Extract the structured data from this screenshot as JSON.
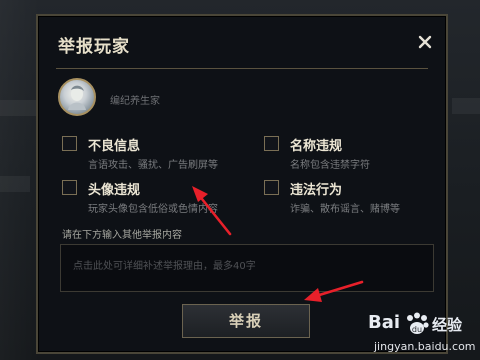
{
  "dialog": {
    "title": "举报玩家",
    "close_glyph": "✕"
  },
  "player": {
    "avatar_icon": "player-avatar",
    "name": "编纪养生家"
  },
  "options": [
    {
      "label": "不良信息",
      "description": "言语攻击、骚扰、广告刷屏等"
    },
    {
      "label": "名称违规",
      "description": "名称包含违禁字符"
    },
    {
      "label": "头像违规",
      "description": "玩家头像包含低俗或色情内容"
    },
    {
      "label": "违法行为",
      "description": "诈骗、散布谣言、赌博等"
    }
  ],
  "details": {
    "prompt": "请在下方输入其他举报内容",
    "placeholder": "点击此处可详细补述举报理由，最多40字"
  },
  "submit_label": "举报",
  "watermark": {
    "brand": "Bai",
    "sub": "经验",
    "url": "jingyan.baidu.com"
  },
  "colors": {
    "accent": "#e8202a",
    "frame": "#4a4638",
    "title": "#e6dfc9"
  }
}
